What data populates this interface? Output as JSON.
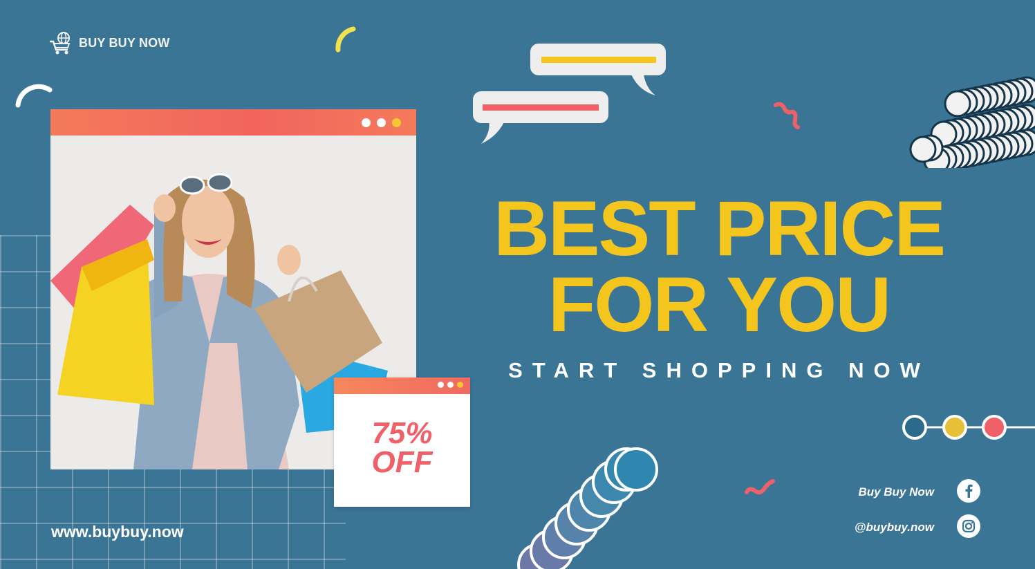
{
  "brand": {
    "name": "BUY BUY NOW",
    "icon": "shopping-cart-globe-icon"
  },
  "hero": {
    "headline_line1": "BEST PRICE",
    "headline_line2": "FOR YOU",
    "subline": "START SHOPPING NOW"
  },
  "photo": {
    "alt": "Smiling woman holding colorful shopping bags"
  },
  "discount": {
    "line1": "75%",
    "line2": "OFF"
  },
  "website": "www.buybuy.now",
  "social": {
    "facebook": {
      "label": "Buy Buy Now",
      "icon": "facebook-icon"
    },
    "instagram": {
      "label": "@buybuy.now",
      "icon": "instagram-icon"
    }
  },
  "colors": {
    "background": "#3a7596",
    "headline": "#f3c51d",
    "accent_coral": "#f1645e",
    "accent_yellow": "#f5c933",
    "accent_pink": "#f06068"
  }
}
